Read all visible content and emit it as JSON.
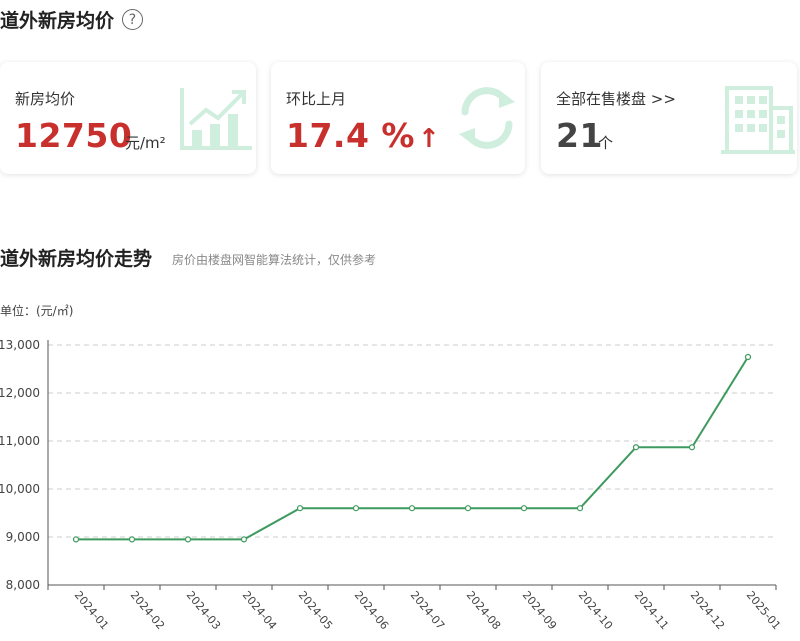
{
  "header": {
    "title": "道外新房均价",
    "help_icon": "question-circle-icon"
  },
  "cards": [
    {
      "label": "新房均价",
      "value": "12750",
      "unit": "元/m²",
      "icon": "trend-chart-icon"
    },
    {
      "label": "环比上月",
      "value": "17.4 %",
      "arrow": "↑",
      "icon": "refresh-cycle-icon"
    },
    {
      "label": "全部在售楼盘 >>",
      "value": "21",
      "unit": "个",
      "icon": "building-icon"
    }
  ],
  "section": {
    "title": "道外新房均价走势",
    "note": "房价由楼盘网智能算法统计，仅供参考"
  },
  "unit_label": "单位：(元/㎡)",
  "colors": {
    "accent_red": "#c8302d",
    "line_green": "#3e9a5e",
    "icon_green": "#cfeede"
  },
  "chart_data": {
    "type": "line",
    "categories": [
      "2024-01",
      "2024-02",
      "2024-03",
      "2024-04",
      "2024-05",
      "2024-06",
      "2024-07",
      "2024-08",
      "2024-09",
      "2024-10",
      "2024-11",
      "2024-12",
      "2025-01"
    ],
    "series": [
      {
        "values": [
          8950,
          8950,
          8950,
          8950,
          9600,
          9600,
          9600,
          9600,
          9600,
          9600,
          10870,
          10870,
          12750
        ]
      }
    ],
    "ylim": [
      8000,
      13000
    ],
    "yticks": [
      8000,
      9000,
      10000,
      11000,
      12000,
      13000
    ],
    "ytick_labels": [
      "8,000",
      "9,000",
      "10,000",
      "11,000",
      "12,000",
      "13,000"
    ],
    "grid": "horizontal-dashed"
  }
}
